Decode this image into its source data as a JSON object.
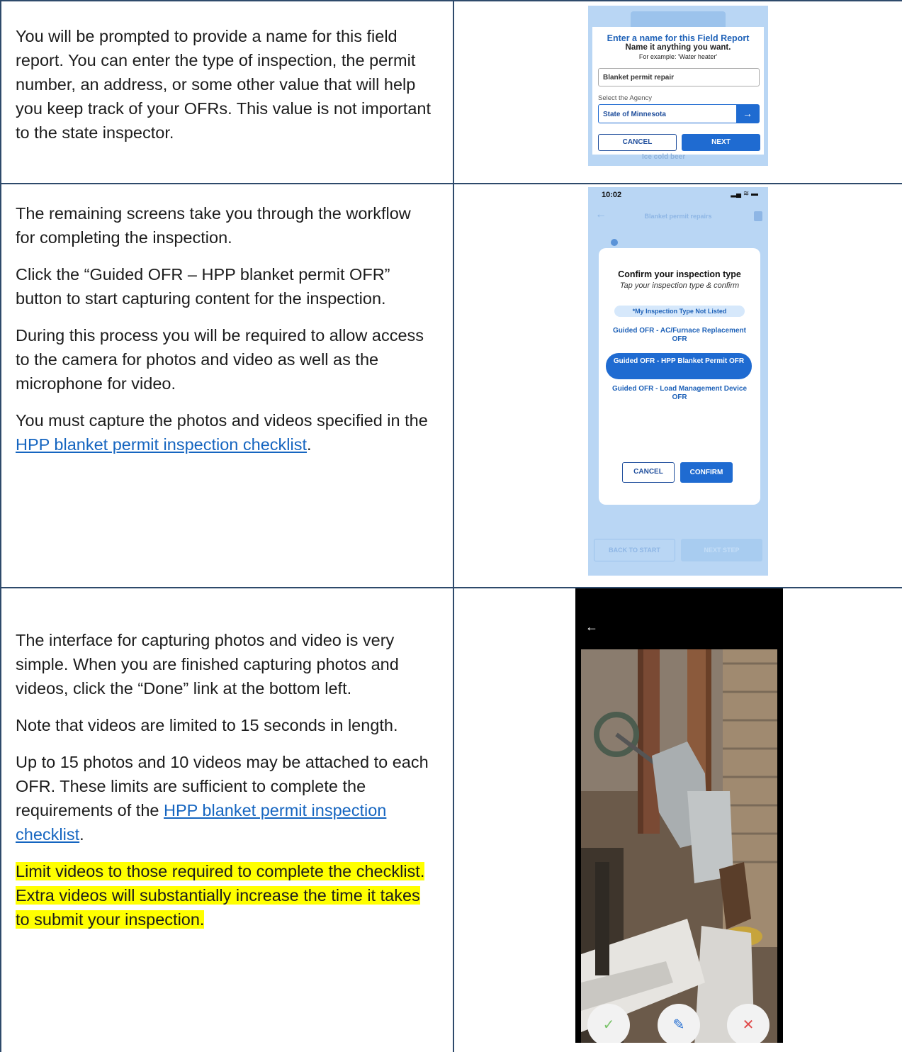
{
  "row1": {
    "text": "You will be prompted to provide a name for this field report. You can enter the type of inspection, the permit number, an address, or some other value that will help you keep track of your OFRs. This value is not important to the state inspector.",
    "screenshot": {
      "dialog_title": "Enter a name for this Field Report",
      "dialog_subtitle": "Name it anything you want.",
      "dialog_example": "For example: 'Water heater'",
      "name_input_value": "Blanket permit repair",
      "agency_label": "Select the Agency",
      "agency_value": "State of Minnesota",
      "arrow_glyph": "→",
      "cancel_label": "CANCEL",
      "next_label": "NEXT",
      "background_item": "Ice cold beer"
    }
  },
  "row2": {
    "para1": "The remaining screens take you through the workflow for completing the inspection.",
    "para2": "Click the “Guided OFR – HPP blanket permit OFR” button to start capturing content for the inspection.",
    "para3": "During this process you will be required to allow access to the camera for photos and video as well as the microphone for video.",
    "para4_before": "You must capture the photos and videos specified in the ",
    "para4_link": "HPP blanket permit inspection checklist",
    "para4_after": ".",
    "screenshot": {
      "time": "10:02",
      "status_icons": "▂▄ ≋ ▬",
      "back_glyph": "←",
      "header_title": "Blanket permit repairs",
      "dialog_title": "Confirm your inspection type",
      "dialog_subtitle": "Tap your inspection type & confirm",
      "not_listed": "*My Inspection Type Not Listed",
      "options": [
        "Guided OFR - AC/Furnace Replacement OFR",
        "Guided OFR - HPP Blanket Permit OFR",
        "Guided OFR - Load Management Device OFR"
      ],
      "cancel_label": "CANCEL",
      "confirm_label": "CONFIRM",
      "back_to_start": "BACK TO START",
      "next_step": "NEXT STEP"
    }
  },
  "row3": {
    "para1": "The interface for capturing photos and video is very simple. When you are finished capturing photos and videos, click the “Done” link at the bottom left.",
    "para2": "Note that videos are limited to 15 seconds in length.",
    "para3_before": "Up to 15 photos and 10 videos may be attached to each OFR. These limits are sufficient to complete the requirements of the ",
    "para3_link": "HPP blanket permit inspection checklist",
    "para3_after": ".",
    "para4_highlight": "Limit videos to those required to complete the checklist. Extra videos will substantially increase the time it takes to submit your inspection.",
    "screenshot": {
      "back_glyph": "←",
      "accept_glyph": "✓",
      "edit_glyph": "✎",
      "delete_glyph": "✕"
    }
  },
  "colors": {
    "border": "#2e4a6b",
    "link": "#1565c0",
    "highlight": "#ffff00",
    "app_blue": "#1f6bd1",
    "app_background": "#b9d6f4"
  }
}
